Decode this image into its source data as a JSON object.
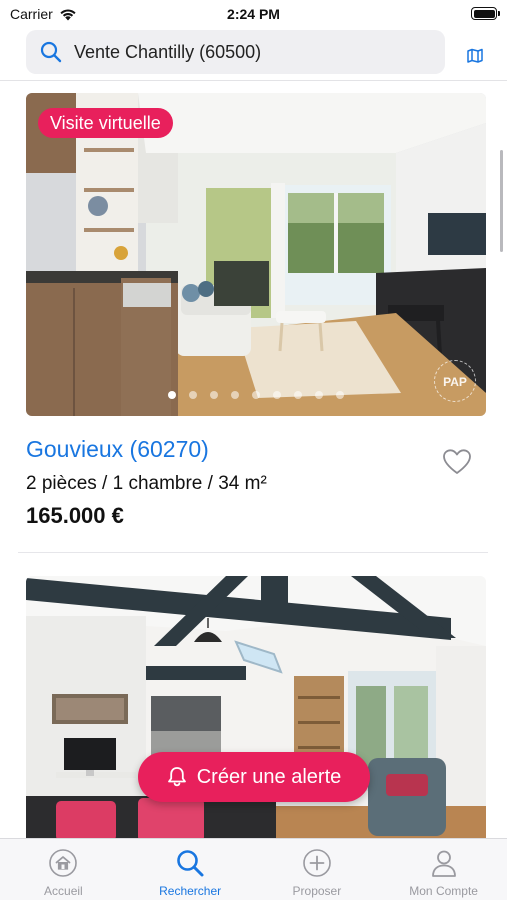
{
  "status_bar": {
    "carrier": "Carrier",
    "time": "2:24 PM"
  },
  "search": {
    "query": "Vente Chantilly (60500)",
    "map_icon": "map-icon"
  },
  "listings": [
    {
      "badge": "Visite virtuelle",
      "title": "Gouvieux (60270)",
      "specs": "2 pièces / 1 chambre / 34 m²",
      "price": "165.000 €",
      "photo_count": 9,
      "active_photo": 1,
      "watermark": "PAP"
    },
    {
      "badge": "",
      "title": "",
      "specs": "",
      "price": ""
    }
  ],
  "alert_button": {
    "label": "Créer une alerte",
    "icon": "bell-icon"
  },
  "tabs": [
    {
      "label": "Accueil",
      "icon": "home-icon",
      "active": false
    },
    {
      "label": "Rechercher",
      "icon": "search-icon",
      "active": true
    },
    {
      "label": "Proposer",
      "icon": "plus-circle-icon",
      "active": false
    },
    {
      "label": "Mon Compte",
      "icon": "user-icon",
      "active": false
    }
  ],
  "colors": {
    "accent": "#e8205c",
    "link_blue": "#1976e0",
    "inactive_tab": "#9a9aa0"
  }
}
